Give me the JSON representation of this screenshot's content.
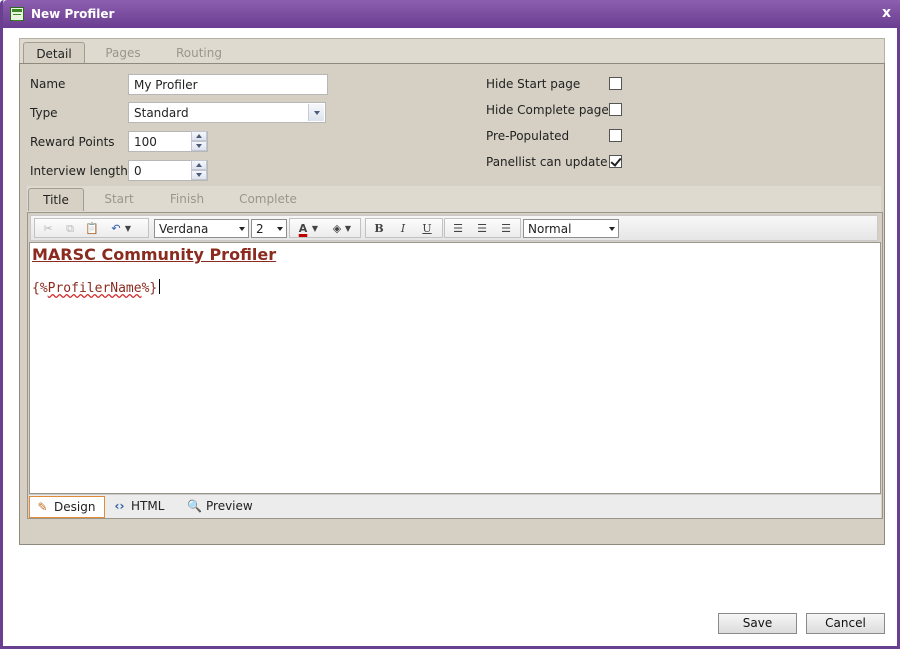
{
  "window": {
    "title": "New Profiler",
    "close_symbol": "x"
  },
  "outer_tabs": [
    {
      "label": "Detail",
      "active": true
    },
    {
      "label": "Pages",
      "active": false
    },
    {
      "label": "Routing",
      "active": false
    }
  ],
  "form": {
    "name": {
      "label": "Name",
      "value": "My Profiler"
    },
    "type": {
      "label": "Type",
      "value": "Standard"
    },
    "reward_points": {
      "label": "Reward Points",
      "value": "100"
    },
    "interview_length": {
      "label": "Interview length",
      "value": "0"
    },
    "hide_start_page": {
      "label": "Hide Start page",
      "checked": false
    },
    "hide_complete_page": {
      "label": "Hide Complete page",
      "checked": false
    },
    "pre_populated": {
      "label": "Pre-Populated",
      "checked": false
    },
    "panellist_can_update": {
      "label": "Panellist can update",
      "checked": true
    }
  },
  "inner_tabs": [
    {
      "label": "Title",
      "active": true
    },
    {
      "label": "Start",
      "active": false
    },
    {
      "label": "Finish",
      "active": false
    },
    {
      "label": "Complete",
      "active": false
    }
  ],
  "toolbar": {
    "font": "Verdana",
    "size": "2",
    "format": "Normal",
    "bold": "B",
    "italic": "I",
    "underline": "U",
    "font_color_glyph": "A"
  },
  "editor": {
    "heading": "MARSC Community Profiler",
    "placeholder_open": "{%",
    "placeholder_name": "ProfilerName",
    "placeholder_close": "%}"
  },
  "modes": [
    {
      "label": "Design",
      "icon": "pencil-icon",
      "active": true
    },
    {
      "label": "HTML",
      "icon": "code-icon",
      "active": false
    },
    {
      "label": "Preview",
      "icon": "magnifier-icon",
      "active": false
    }
  ],
  "buttons": {
    "save": "Save",
    "cancel": "Cancel"
  }
}
